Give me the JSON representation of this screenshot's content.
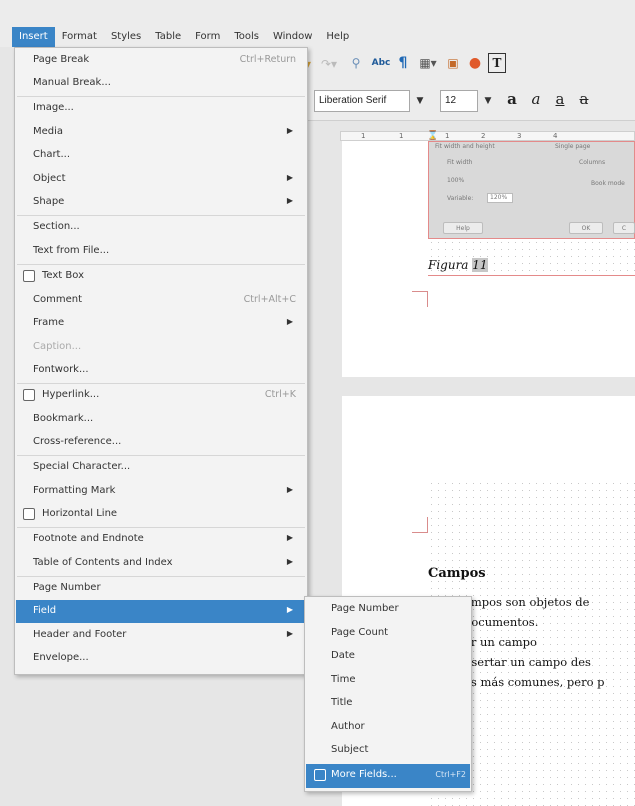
{
  "menubar": {
    "items": [
      {
        "label": "Insert",
        "active": true
      },
      {
        "label": "Format"
      },
      {
        "label": "Styles"
      },
      {
        "label": "Table"
      },
      {
        "label": "Form"
      },
      {
        "label": "Tools"
      },
      {
        "label": "Window"
      },
      {
        "label": "Help"
      }
    ]
  },
  "toolbar": {
    "font_name": "Liberation Serif",
    "font_size": "12",
    "abc_label": "Abc",
    "text_box_glyph": "T",
    "bold_glyph": "a",
    "italic_glyph": "a",
    "underline_glyph": "a",
    "strike_glyph": "a"
  },
  "ruler": {
    "marks": [
      "1",
      "1",
      "1",
      "2",
      "3",
      "4"
    ]
  },
  "document": {
    "dialog_thumbnail": {
      "options": [
        "Fit width",
        "Columns",
        "100%",
        "Book mode",
        "Variable:"
      ],
      "zoom_value": "120%",
      "buttons": [
        "Help",
        "OK",
        "C"
      ],
      "top_left": "Fit width and height",
      "top_right": "Single page"
    },
    "caption_word": "Figura",
    "caption_number": "11",
    "heading": "Campos",
    "lines": [
      "ampos son objetos de",
      "documentos.",
      "ar un campo",
      "nsertar un campo des",
      "os más comunes, pero p"
    ]
  },
  "insert_menu": {
    "items": [
      {
        "label": "Page Break",
        "shortcut": "Ctrl+Return"
      },
      {
        "label": "Manual Break..."
      },
      {
        "label": "Image..."
      },
      {
        "label": "Media",
        "submenu": true
      },
      {
        "label": "Chart..."
      },
      {
        "label": "Object",
        "submenu": true
      },
      {
        "label": "Shape",
        "submenu": true
      },
      {
        "label": "Section..."
      },
      {
        "label": "Text from File..."
      },
      {
        "label": "Text Box",
        "checkbox": true
      },
      {
        "label": "Comment",
        "shortcut": "Ctrl+Alt+C"
      },
      {
        "label": "Frame",
        "submenu": true
      },
      {
        "label": "Caption...",
        "disabled": true
      },
      {
        "label": "Fontwork..."
      },
      {
        "label": "Hyperlink...",
        "shortcut": "Ctrl+K",
        "checkbox": true
      },
      {
        "label": "Bookmark..."
      },
      {
        "label": "Cross-reference..."
      },
      {
        "label": "Special Character..."
      },
      {
        "label": "Formatting Mark",
        "submenu": true
      },
      {
        "label": "Horizontal Line",
        "checkbox": true
      },
      {
        "label": "Footnote and Endnote",
        "submenu": true
      },
      {
        "label": "Table of Contents and Index",
        "submenu": true
      },
      {
        "label": "Page Number"
      },
      {
        "label": "Field",
        "submenu": true,
        "highlighted": true
      },
      {
        "label": "Header and Footer",
        "submenu": true
      },
      {
        "label": "Envelope..."
      }
    ]
  },
  "field_submenu": {
    "items": [
      {
        "label": "Page Number"
      },
      {
        "label": "Page Count"
      },
      {
        "label": "Date"
      },
      {
        "label": "Time"
      },
      {
        "label": "Title"
      },
      {
        "label": "Author"
      },
      {
        "label": "Subject"
      },
      {
        "label": "More Fields...",
        "shortcut": "Ctrl+F2",
        "highlighted": true,
        "checkbox": true
      }
    ]
  },
  "colors": {
    "highlight": "#3a85c7",
    "menu_bg": "#f3f3f3",
    "guide": "#d98c8c"
  }
}
